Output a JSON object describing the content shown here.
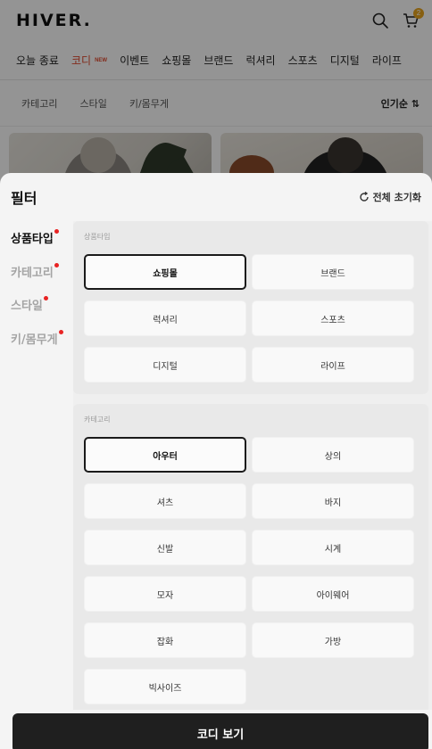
{
  "header": {
    "logo": "HIVER.",
    "cart_count": "2"
  },
  "main_nav": [
    {
      "label": "오늘 종료",
      "active": false
    },
    {
      "label": "코디",
      "active": true,
      "badge": "NEW"
    },
    {
      "label": "이벤트",
      "active": false
    },
    {
      "label": "쇼핑몰",
      "active": false
    },
    {
      "label": "브랜드",
      "active": false
    },
    {
      "label": "럭셔리",
      "active": false
    },
    {
      "label": "스포츠",
      "active": false
    },
    {
      "label": "디지털",
      "active": false
    },
    {
      "label": "라이프",
      "active": false
    }
  ],
  "sub_nav": {
    "items": [
      "카테고리",
      "스타일",
      "키/몸무게"
    ],
    "sort_label": "인기순 ⇅"
  },
  "filter": {
    "title": "필터",
    "reset_label": "전체 초기화",
    "side_items": [
      {
        "label": "상품타입",
        "active": true,
        "dot": true
      },
      {
        "label": "카테고리",
        "active": false,
        "dot": true
      },
      {
        "label": "스타일",
        "active": false,
        "dot": true
      },
      {
        "label": "키/몸무게",
        "active": false,
        "dot": true
      }
    ],
    "groups": [
      {
        "title": "상품타입",
        "options": [
          {
            "label": "쇼핑몰",
            "selected": true
          },
          {
            "label": "브랜드",
            "selected": false
          },
          {
            "label": "럭셔리",
            "selected": false
          },
          {
            "label": "스포츠",
            "selected": false
          },
          {
            "label": "디지털",
            "selected": false
          },
          {
            "label": "라이프",
            "selected": false
          }
        ]
      },
      {
        "title": "카테고리",
        "options": [
          {
            "label": "아우터",
            "selected": true
          },
          {
            "label": "상의",
            "selected": false
          },
          {
            "label": "셔츠",
            "selected": false
          },
          {
            "label": "바지",
            "selected": false
          },
          {
            "label": "신발",
            "selected": false
          },
          {
            "label": "시계",
            "selected": false
          },
          {
            "label": "모자",
            "selected": false
          },
          {
            "label": "아이웨어",
            "selected": false
          },
          {
            "label": "잡화",
            "selected": false
          },
          {
            "label": "가방",
            "selected": false
          },
          {
            "label": "빅사이즈",
            "selected": false
          }
        ]
      }
    ],
    "apply_label": "코디 보기"
  }
}
